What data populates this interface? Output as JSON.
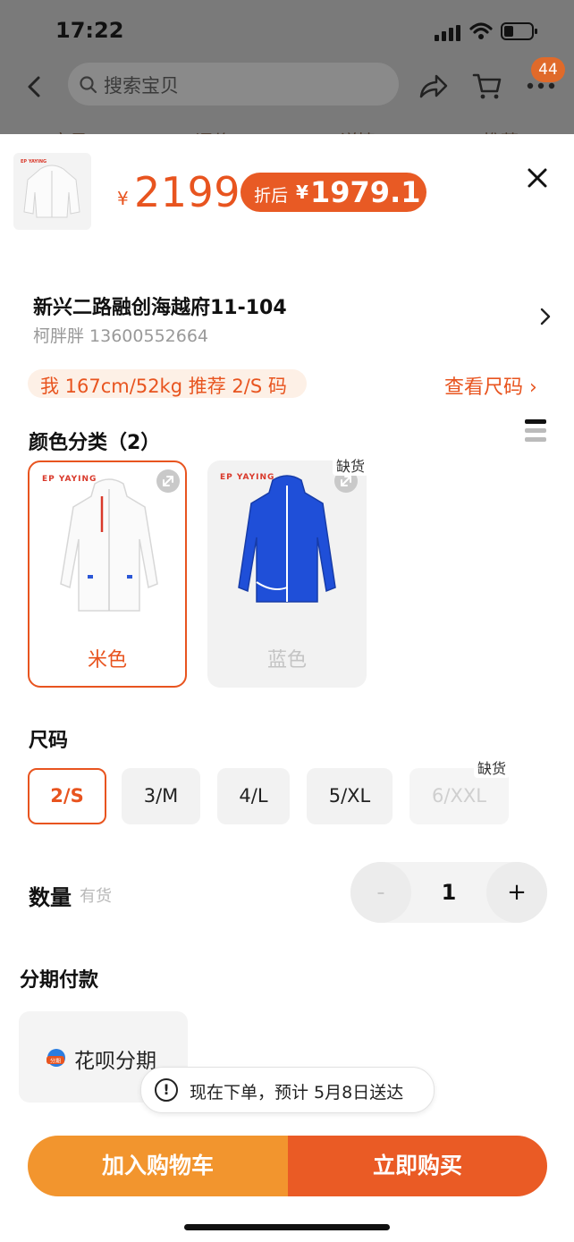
{
  "status": {
    "time": "17:22"
  },
  "topbar": {
    "search_placeholder": "搜索宝贝",
    "cart_badge": "44",
    "tabs": [
      "宝贝",
      "评价",
      "详情",
      "推荐"
    ]
  },
  "product": {
    "price_symbol": "¥",
    "price": "2199",
    "discount_label": "折后",
    "discount_symbol": "¥",
    "discount_price": "1979.1",
    "brand": "EP YAYING"
  },
  "address": {
    "line1": "新兴二路融创海越府11-104",
    "line2": "柯胖胖 13600552664"
  },
  "size_recommend": {
    "text": "我 167cm/52kg 推荐 2/S 码",
    "link": "查看尺码 ›"
  },
  "color_section": {
    "title": "颜色分类（2）",
    "options": [
      {
        "name": "米色",
        "selected": true,
        "out_of_stock": false
      },
      {
        "name": "蓝色",
        "selected": false,
        "out_of_stock": true,
        "tag": "缺货"
      }
    ]
  },
  "size_section": {
    "title": "尺码",
    "options": [
      {
        "label": "2/S",
        "state": "selected"
      },
      {
        "label": "3/M",
        "state": "normal"
      },
      {
        "label": "4/L",
        "state": "normal"
      },
      {
        "label": "5/XL",
        "state": "normal"
      },
      {
        "label": "6/XXL",
        "state": "disabled",
        "tag": "缺货"
      }
    ]
  },
  "quantity": {
    "label": "数量",
    "stock": "有货",
    "value": "1",
    "minus": "-",
    "plus": "+"
  },
  "installment": {
    "title": "分期付款",
    "option_label": "花呗分期",
    "icon_text": "分期"
  },
  "toast": {
    "icon": "!",
    "text": "现在下单，预计 5月8日送达"
  },
  "actions": {
    "add_to_cart": "加入购物车",
    "buy_now": "立即购买"
  },
  "colors": {
    "accent": "#e8541f",
    "cart_button": "#f2952e",
    "buy_button": "#ea5b25",
    "jacket_blue": "#1f4fd8"
  }
}
